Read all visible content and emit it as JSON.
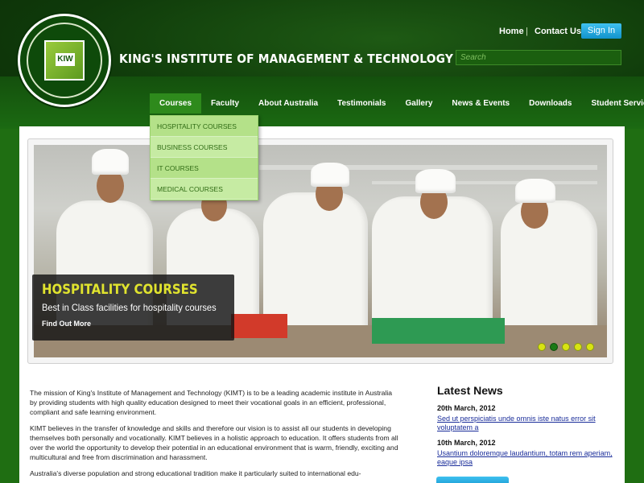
{
  "header": {
    "brand_title": "KING'S INSTITUTE OF MANAGEMENT & TECHNOLOGY",
    "logo_text": "KIW",
    "top_links": {
      "home": "Home",
      "separator": "|",
      "contact": "Contact Us"
    },
    "signin_label": "Sign In",
    "search_placeholder": "Search"
  },
  "nav": {
    "items": [
      "Courses",
      "Faculty",
      "About Australia",
      "Testimonials",
      "Gallery",
      "News & Events",
      "Downloads",
      "Student Services"
    ],
    "active_index": 0
  },
  "dropdown": {
    "items": [
      "HOSPITALITY COURSES",
      "BUSINESS COURSES",
      "IT COURSES",
      "MEDICAL COURSES"
    ]
  },
  "slider": {
    "caption_title": "HOSPITALITY COURSES",
    "caption_subtitle": "Best in Class facilities for hospitality courses",
    "caption_link": "Find Out More",
    "slide_count": 5,
    "active_slide": 2
  },
  "mission": {
    "paragraphs": [
      "The mission of King's Institute of Management and Technology (KIMT) is to be a leading academic institute in Australia by providing students with high quality education designed to meet their vocational goals in an efficient, professional, compliant and safe learning environment.",
      "KIMT believes in the transfer of knowledge and skills and therefore our vision is to assist all our students in developing themselves both personally and vocationally. KIMT believes in a holistic approach to education. It offers students from all over the world the opportunity to develop their potential in an educational environment that is warm, friendly, exciting and multicultural and free from discrimination and harassment.",
      "Australia's diverse population and strong educational tradition make it particularly suited to international edu-"
    ]
  },
  "news": {
    "title": "Latest News",
    "items": [
      {
        "date": "20th March, 2012",
        "text": "Sed ut perspiciatis unde omnis iste natus error sit voluptatem a"
      },
      {
        "date": "10th March, 2012",
        "text": "Usantium doloremque laudantium, totam rem aperiam, eaque ipsa"
      }
    ]
  },
  "colors": {
    "brand_green": "#1f6e12",
    "nav_active": "#2e8a1c",
    "signin_blue": "#1293cc",
    "caption_yellow": "#e0e32e",
    "dot_yellow": "#d8e313"
  }
}
